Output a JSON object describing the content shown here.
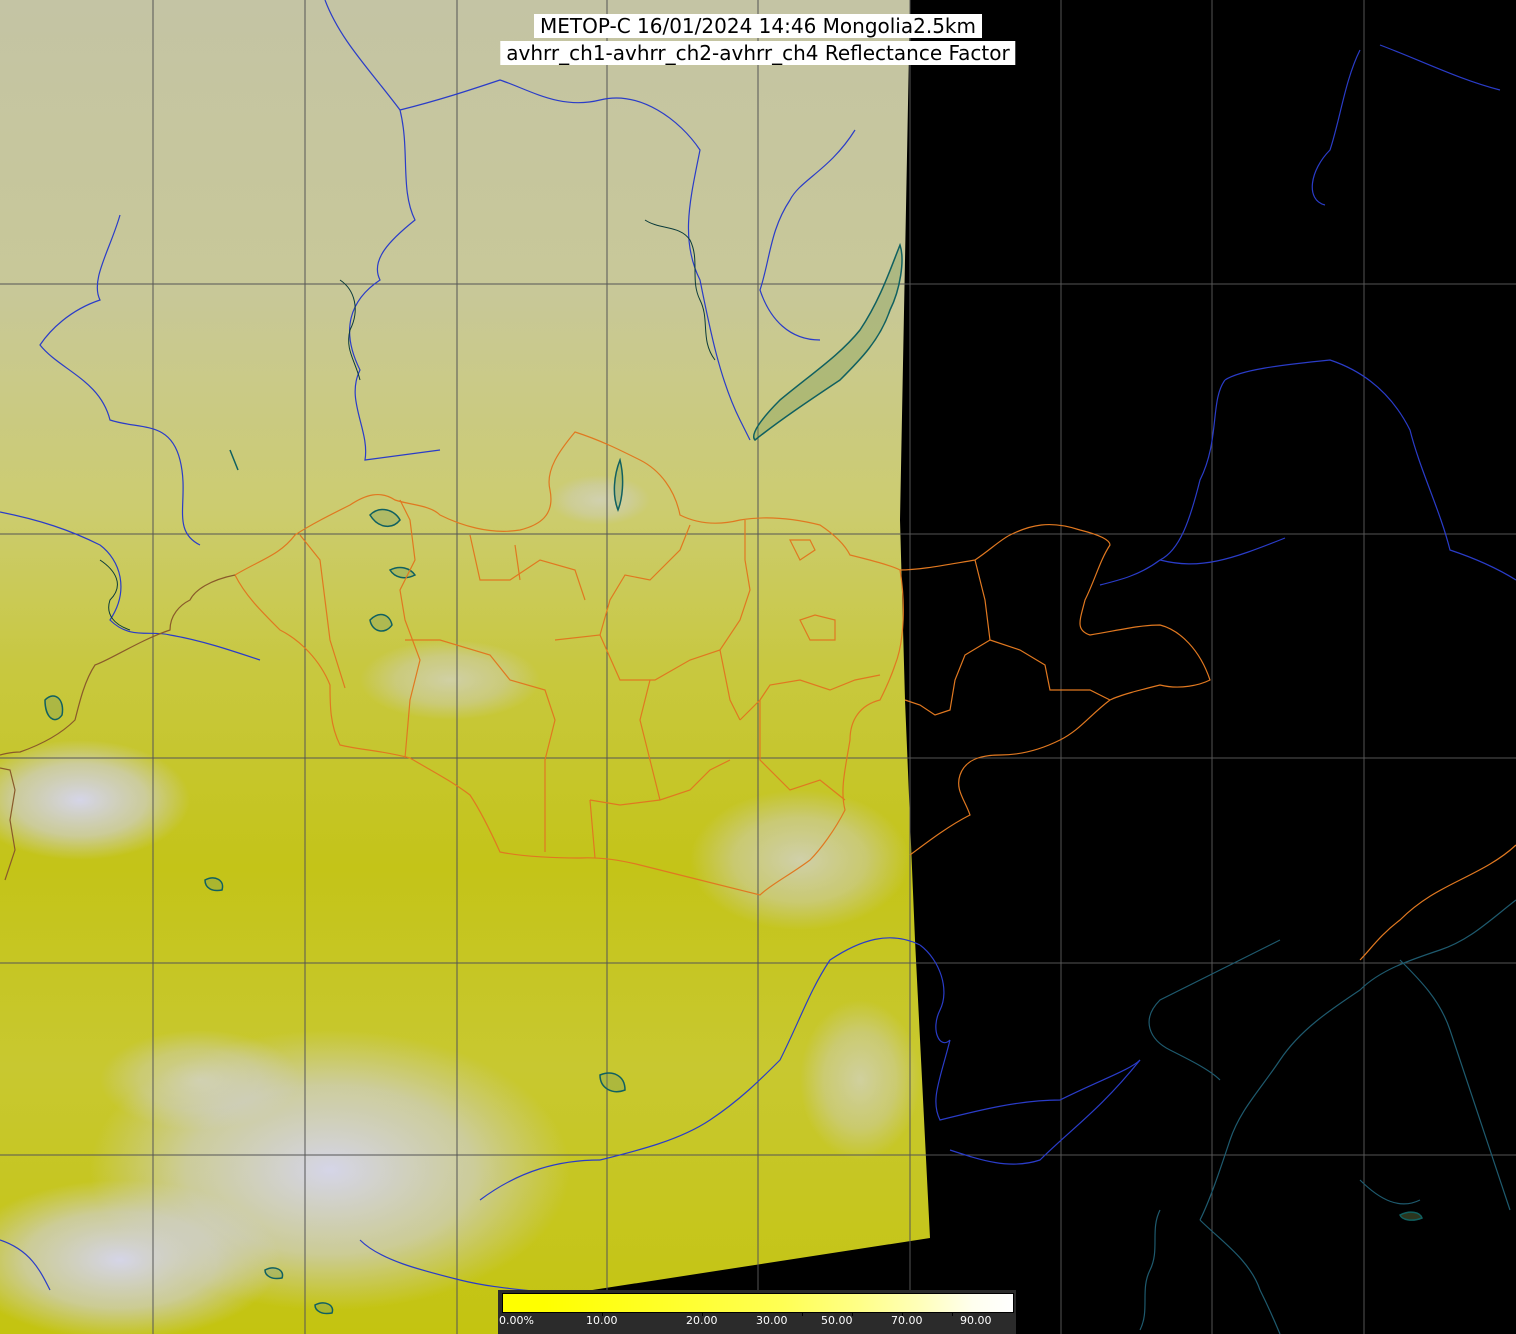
{
  "header": {
    "line1": "METOP-C 16/01/2024 14:46 Mongolia2.5km",
    "line2": "avhrr_ch1-avhrr_ch2-avhrr_ch4 Reflectance Factor"
  },
  "colors": {
    "background": "#000000",
    "swath_light": "#c8c8a8",
    "swath_yellow": "#c8c800",
    "cloud": "#d8d8f0",
    "rivers": "#2a3cc8",
    "coastline_dark": "#1e5a6e",
    "borders": "#e07820",
    "grid": "#555555",
    "lakes": "#106060"
  },
  "colorbar": {
    "labels": [
      "0.00%",
      "10.00",
      "20.00",
      "30.00",
      "50.00",
      "70.00",
      "90.00"
    ]
  }
}
